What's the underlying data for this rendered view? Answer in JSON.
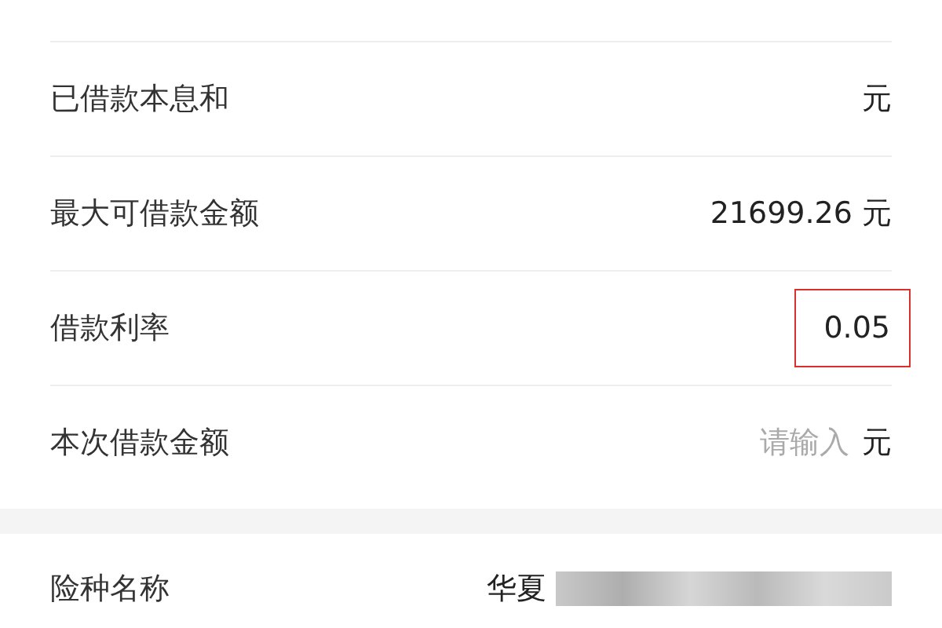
{
  "rows": [
    {
      "label": "已借款本息和",
      "value": "",
      "unit": "元",
      "kind": "text",
      "highlighted": false
    },
    {
      "label": "最大可借款金额",
      "value": "21699.26",
      "unit": "元",
      "kind": "text",
      "highlighted": false
    },
    {
      "label": "借款利率",
      "value": "0.05",
      "unit": "",
      "kind": "text",
      "highlighted": true
    },
    {
      "label": "本次借款金额",
      "placeholder": "请输入",
      "unit": "元",
      "kind": "input",
      "highlighted": false
    }
  ],
  "insurance": {
    "label": "险种名称",
    "value": "华夏"
  }
}
